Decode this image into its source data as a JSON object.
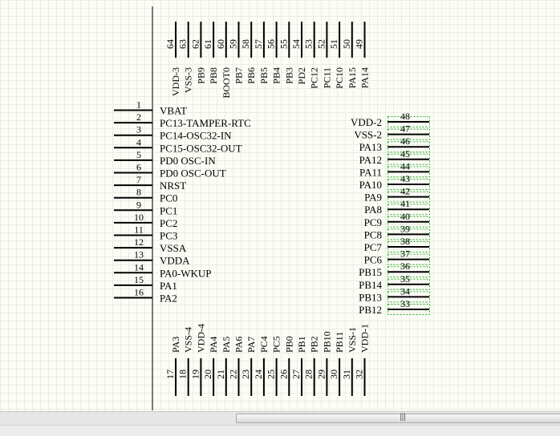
{
  "left_pins": [
    {
      "num": "1",
      "name": "VBAT"
    },
    {
      "num": "2",
      "name": "PC13-TAMPER-RTC"
    },
    {
      "num": "3",
      "name": "PC14-OSC32-IN"
    },
    {
      "num": "4",
      "name": "PC15-OSC32-OUT"
    },
    {
      "num": "5",
      "name": "PD0 OSC-IN"
    },
    {
      "num": "6",
      "name": "PD0 OSC-OUT"
    },
    {
      "num": "7",
      "name": "NRST"
    },
    {
      "num": "8",
      "name": "PC0"
    },
    {
      "num": "9",
      "name": "PC1"
    },
    {
      "num": "10",
      "name": "PC2"
    },
    {
      "num": "11",
      "name": "PC3"
    },
    {
      "num": "12",
      "name": "VSSA"
    },
    {
      "num": "13",
      "name": "VDDA"
    },
    {
      "num": "14",
      "name": "PA0-WKUP"
    },
    {
      "num": "15",
      "name": "PA1"
    },
    {
      "num": "16",
      "name": "PA2"
    }
  ],
  "right_pins": [
    {
      "num": "48",
      "name": "VDD-2"
    },
    {
      "num": "47",
      "name": "VSS-2"
    },
    {
      "num": "46",
      "name": "PA13"
    },
    {
      "num": "45",
      "name": "PA12"
    },
    {
      "num": "44",
      "name": "PA11"
    },
    {
      "num": "43",
      "name": "PA10"
    },
    {
      "num": "42",
      "name": "PA9"
    },
    {
      "num": "41",
      "name": "PA8"
    },
    {
      "num": "40",
      "name": "PC9"
    },
    {
      "num": "39",
      "name": "PC8"
    },
    {
      "num": "38",
      "name": "PC7"
    },
    {
      "num": "37",
      "name": "PC6"
    },
    {
      "num": "36",
      "name": "PB15"
    },
    {
      "num": "35",
      "name": "PB14"
    },
    {
      "num": "34",
      "name": "PB13"
    },
    {
      "num": "33",
      "name": "PB12"
    }
  ],
  "top_pins": [
    {
      "num": "64",
      "name": "VDD-3"
    },
    {
      "num": "63",
      "name": "VSS-3"
    },
    {
      "num": "62",
      "name": "PB9"
    },
    {
      "num": "61",
      "name": "PB8"
    },
    {
      "num": "60",
      "name": "BOOT0"
    },
    {
      "num": "59",
      "name": "PB7"
    },
    {
      "num": "58",
      "name": "PB6"
    },
    {
      "num": "57",
      "name": "PB5"
    },
    {
      "num": "56",
      "name": "PB4"
    },
    {
      "num": "55",
      "name": "PB3"
    },
    {
      "num": "54",
      "name": "PD2"
    },
    {
      "num": "53",
      "name": "PC12"
    },
    {
      "num": "52",
      "name": "PC11"
    },
    {
      "num": "51",
      "name": "PC10"
    },
    {
      "num": "50",
      "name": "PA15"
    },
    {
      "num": "49",
      "name": "PA14"
    }
  ],
  "bottom_pins": [
    {
      "num": "17",
      "name": "PA3"
    },
    {
      "num": "18",
      "name": "VSS-4"
    },
    {
      "num": "19",
      "name": "VDD-4"
    },
    {
      "num": "20",
      "name": "PA4"
    },
    {
      "num": "21",
      "name": "PA5"
    },
    {
      "num": "22",
      "name": "PA6"
    },
    {
      "num": "23",
      "name": "PA7"
    },
    {
      "num": "24",
      "name": "PC4"
    },
    {
      "num": "25",
      "name": "PC5"
    },
    {
      "num": "26",
      "name": "PB0"
    },
    {
      "num": "27",
      "name": "PB1"
    },
    {
      "num": "28",
      "name": "PB2"
    },
    {
      "num": "29",
      "name": "PB10"
    },
    {
      "num": "30",
      "name": "PB11"
    },
    {
      "num": "31",
      "name": "VSS-1"
    },
    {
      "num": "32",
      "name": "VDD-1"
    }
  ],
  "selected_pins": [
    "48",
    "47",
    "46",
    "45",
    "44",
    "43",
    "42",
    "41",
    "40",
    "39",
    "38",
    "37",
    "36",
    "35",
    "34",
    "33"
  ],
  "scrollbar": {
    "grip": "|||"
  },
  "colors": {
    "background": "#fdfdf8",
    "grid": "#ecece2",
    "pin": "#000000",
    "selection": "#22b022"
  },
  "icons": {
    "scroll_grip": "scroll-grip-icon"
  }
}
